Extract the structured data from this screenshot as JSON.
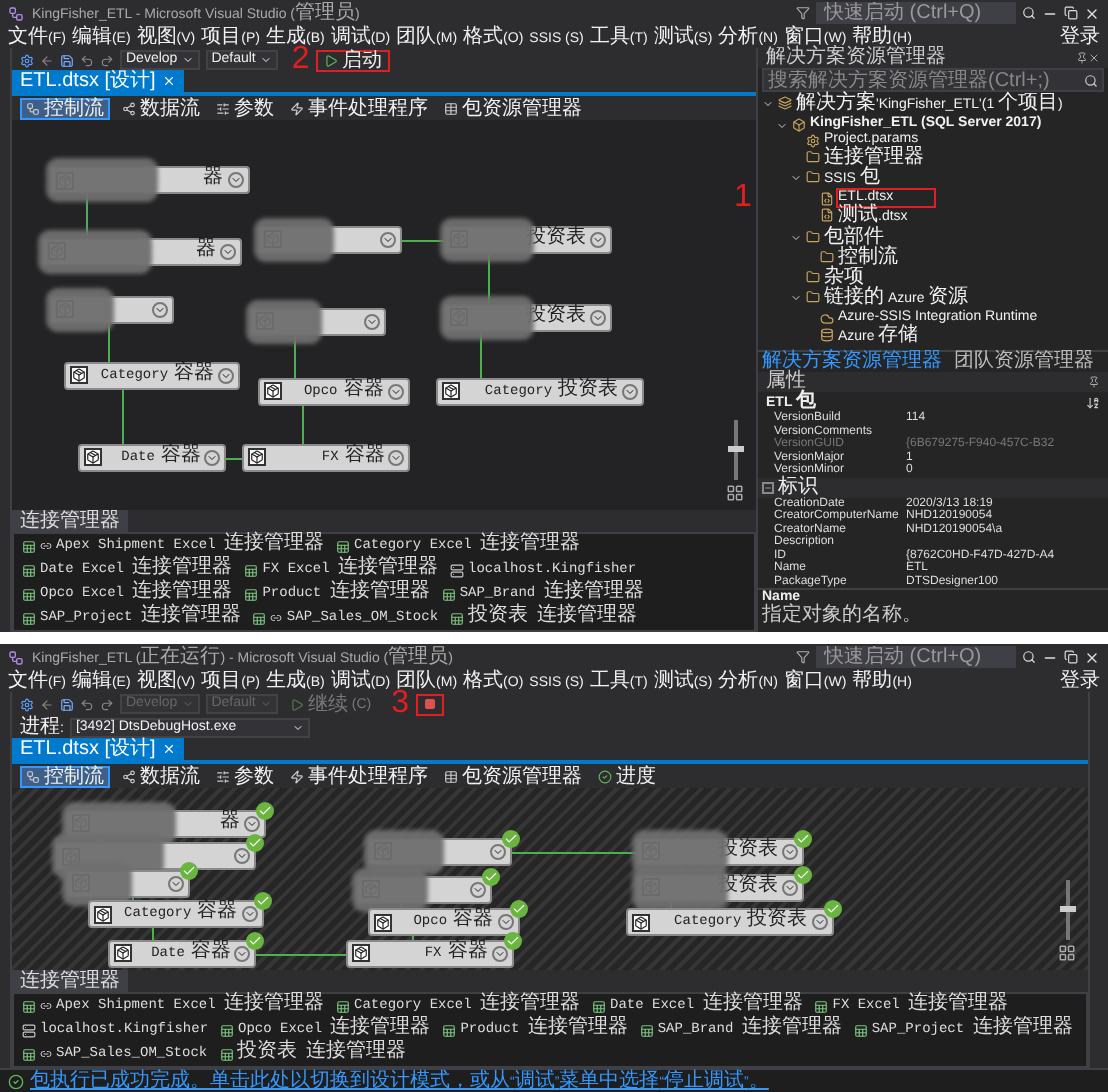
{
  "windows": [
    {
      "title": "KingFisher_ETL - Microsoft Visual Studio (管理员)",
      "running": false,
      "quick_launch": {
        "placeholder": "快速启动 (Ctrl+Q)"
      },
      "menu": [
        "文件(F)",
        "编辑(E)",
        "视图(V)",
        "项目(P)",
        "生成(B)",
        "调试(D)",
        "团队(M)",
        "格式(O)",
        "SSIS (S)",
        "工具(T)",
        "测试(S)",
        "分析(N)",
        "窗口(W)",
        "帮助(H)"
      ],
      "sign_in": "登录",
      "toolbar": {
        "configuration": {
          "label": "Develop",
          "disabled": false
        },
        "platform": {
          "label": "Default",
          "disabled": false
        },
        "buttons": [
          {
            "kind": "start",
            "label": "启动",
            "annotation": "2",
            "disabled": false
          }
        ]
      },
      "document_tab": "ETL.dtsx [设计]",
      "designer_tabs": [
        {
          "label": "控制流",
          "selected": true
        },
        {
          "label": "数据流",
          "selected": false
        },
        {
          "label": "参数",
          "selected": false
        },
        {
          "label": "事件处理程序",
          "selected": false
        },
        {
          "label": "包资源管理器",
          "selected": false
        }
      ],
      "canvas": {
        "zoom": {
          "level": 0.5
        },
        "nodes": [
          {
            "label": "器",
            "redacted": true,
            "succeeded": false
          },
          {
            "redacted": true,
            "succeeded": false
          },
          {
            "label": "投资表",
            "redacted": true,
            "succeeded": false
          },
          {
            "label": "器",
            "redacted": true,
            "succeeded": false
          },
          {
            "redacted": true,
            "succeeded": false
          },
          {
            "label": "投资表",
            "redacted": true,
            "succeeded": false
          },
          {
            "redacted": true,
            "succeeded": false
          },
          {
            "label": "Category 容器",
            "redacted": false,
            "succeeded": false
          },
          {
            "label": "Opco 容器",
            "redacted": false,
            "succeeded": false
          },
          {
            "label": "Category 投资表",
            "redacted": false,
            "succeeded": false
          },
          {
            "label": "Date 容器",
            "redacted": false,
            "succeeded": false
          },
          {
            "label": "FX 容器",
            "redacted": false,
            "succeeded": false
          }
        ]
      },
      "connection_managers": {
        "title": "连接管理器",
        "items": [
          {
            "label": "Apex Shipment Excel 连接管理器",
            "kind": "excel",
            "project": true
          },
          {
            "label": "Category Excel 连接管理器",
            "kind": "excel",
            "project": false
          },
          {
            "label": "Date Excel 连接管理器",
            "kind": "excel",
            "project": false
          },
          {
            "label": "FX Excel 连接管理器",
            "kind": "excel",
            "project": false
          },
          {
            "label": "localhost.Kingfisher",
            "kind": "oledb",
            "project": false
          },
          {
            "label": "Opco Excel 连接管理器",
            "kind": "excel",
            "project": false
          },
          {
            "label": "Product 连接管理器",
            "kind": "excel",
            "project": false
          },
          {
            "label": "SAP_Brand 连接管理器",
            "kind": "excel",
            "project": false
          },
          {
            "label": "SAP_Project 连接管理器",
            "kind": "excel",
            "project": false
          },
          {
            "label": "SAP_Sales_OM_Stock",
            "kind": "excel",
            "project": true
          },
          {
            "label": "投资表 连接管理器",
            "kind": "excel",
            "project": false
          }
        ]
      },
      "solution_explorer": {
        "title": "解决方案资源管理器",
        "search": {
          "placeholder": "搜索解决方案资源管理器(Ctrl+;)"
        },
        "tree": [
          {
            "label": "解决方案'KingFisher_ETL'(1 个项目)",
            "kind": "solution",
            "expanded": true,
            "children": [
              {
                "label": "KingFisher_ETL (SQL Server 2017)",
                "kind": "project",
                "expanded": true,
                "children": [
                  {
                    "label": "Project.params",
                    "kind": "params"
                  },
                  {
                    "label": "连接管理器",
                    "kind": "folder"
                  },
                  {
                    "label": "SSIS 包",
                    "kind": "folder",
                    "expanded": true,
                    "children": [
                      {
                        "label": "ETL.dtsx",
                        "kind": "package",
                        "annotation": "1"
                      },
                      {
                        "label": "测试.dtsx",
                        "kind": "package"
                      }
                    ]
                  },
                  {
                    "label": "包部件",
                    "kind": "folder",
                    "expanded": true,
                    "children": [
                      {
                        "label": "控制流",
                        "kind": "folder"
                      }
                    ]
                  },
                  {
                    "label": "杂项",
                    "kind": "folder"
                  },
                  {
                    "label": "链接的 Azure 资源",
                    "kind": "folder",
                    "expanded": true,
                    "children": [
                      {
                        "label": "Azure-SSIS Integration Runtime",
                        "kind": "runtime"
                      },
                      {
                        "label": "Azure 存储",
                        "kind": "storage"
                      }
                    ]
                  }
                ]
              }
            ]
          }
        ],
        "tabs": [
          {
            "label": "解决方案资源管理器",
            "selected": true
          },
          {
            "label": "团队资源管理器",
            "selected": false
          }
        ]
      },
      "properties": {
        "title": "属性",
        "object": "ETL 包",
        "rows": [
          {
            "kind": "row",
            "name": "VersionBuild",
            "value": "114",
            "disabled": false
          },
          {
            "kind": "row",
            "name": "VersionComments",
            "disabled": false
          },
          {
            "kind": "row",
            "name": "VersionGUID",
            "value": "{6B679275-F940-457C-B32",
            "disabled": true
          },
          {
            "kind": "row",
            "name": "VersionMajor",
            "value": "1",
            "disabled": false
          },
          {
            "kind": "row",
            "name": "VersionMinor",
            "value": "0",
            "disabled": false
          },
          {
            "kind": "category",
            "name": "标识"
          },
          {
            "kind": "row",
            "name": "CreationDate",
            "value": "2020/3/13 18:19",
            "disabled": false
          },
          {
            "kind": "row",
            "name": "CreatorComputerName",
            "value": "NHD120190054",
            "disabled": false
          },
          {
            "kind": "row",
            "name": "CreatorName",
            "value": "NHD120190054\\a",
            "disabled": false
          },
          {
            "kind": "row",
            "name": "Description",
            "disabled": false
          },
          {
            "kind": "row",
            "name": "ID",
            "value": "{8762C0HD-F47D-427D-A4",
            "disabled": false
          },
          {
            "kind": "row",
            "name": "Name",
            "value": "ETL",
            "disabled": false
          },
          {
            "kind": "row",
            "name": "PackageType",
            "value": "DTSDesigner100",
            "disabled": false
          }
        ],
        "description": {
          "title": "Name",
          "text": "指定对象的名称。"
        }
      }
    },
    {
      "title": "KingFisher_ETL (正在运行) - Microsoft Visual Studio (管理员)",
      "running": true,
      "quick_launch": {
        "placeholder": "快速启动 (Ctrl+Q)"
      },
      "menu": [
        "文件(F)",
        "编辑(E)",
        "视图(V)",
        "项目(P)",
        "生成(B)",
        "调试(D)",
        "团队(M)",
        "格式(O)",
        "SSIS (S)",
        "工具(T)",
        "测试(S)",
        "分析(N)",
        "窗口(W)",
        "帮助(H)"
      ],
      "sign_in": "登录",
      "toolbar": {
        "configuration": {
          "label": "Develop",
          "disabled": true
        },
        "platform": {
          "label": "Default",
          "disabled": true
        },
        "buttons": [
          {
            "kind": "start",
            "label": "继续(C)",
            "disabled": true
          },
          {
            "kind": "stop",
            "annotation": "3",
            "disabled": false
          }
        ]
      },
      "debug_toolbar": {
        "process_label": "进程:",
        "process": "[3492] DtsDebugHost.exe"
      },
      "document_tab": "ETL.dtsx [设计]",
      "designer_tabs": [
        {
          "label": "控制流",
          "selected": true
        },
        {
          "label": "数据流",
          "selected": false
        },
        {
          "label": "参数",
          "selected": false
        },
        {
          "label": "事件处理程序",
          "selected": false
        },
        {
          "label": "包资源管理器",
          "selected": false
        },
        {
          "label": "进度",
          "selected": false
        }
      ],
      "canvas": {
        "zoom": {
          "level": 0.5
        },
        "nodes": [
          {
            "label": "器",
            "redacted": true,
            "succeeded": true
          },
          {
            "redacted": true,
            "succeeded": true
          },
          {
            "label": "投资表",
            "redacted": true,
            "succeeded": true
          },
          {
            "redacted": true,
            "succeeded": true
          },
          {
            "redacted": true,
            "succeeded": true
          },
          {
            "label": "投资表",
            "redacted": true,
            "succeeded": true
          },
          {
            "redacted": true,
            "succeeded": true
          },
          {
            "label": "Category 容器",
            "redacted": false,
            "succeeded": true
          },
          {
            "label": "Opco 容器",
            "redacted": false,
            "succeeded": true
          },
          {
            "label": "Category 投资表",
            "redacted": false,
            "succeeded": true
          },
          {
            "label": "Date 容器",
            "redacted": false,
            "succeeded": true
          },
          {
            "label": "FX 容器",
            "redacted": false,
            "succeeded": true
          }
        ]
      },
      "connection_managers": {
        "title": "连接管理器",
        "items": [
          {
            "label": "Apex Shipment Excel 连接管理器",
            "kind": "excel",
            "project": true
          },
          {
            "label": "Category Excel 连接管理器",
            "kind": "excel",
            "project": false
          },
          {
            "label": "Date Excel 连接管理器",
            "kind": "excel",
            "project": false
          },
          {
            "label": "FX Excel 连接管理器",
            "kind": "excel",
            "project": false
          },
          {
            "label": "localhost.Kingfisher",
            "kind": "oledb",
            "project": false
          },
          {
            "label": "Opco Excel 连接管理器",
            "kind": "excel",
            "project": false
          },
          {
            "label": "Product 连接管理器",
            "kind": "excel",
            "project": false
          },
          {
            "label": "SAP_Brand 连接管理器",
            "kind": "excel",
            "project": false
          },
          {
            "label": "SAP_Project 连接管理器",
            "kind": "excel",
            "project": false
          },
          {
            "label": "SAP_Sales_OM_Stock",
            "kind": "excel",
            "project": true
          },
          {
            "label": "投资表 连接管理器",
            "kind": "excel",
            "project": false
          }
        ]
      },
      "status": {
        "text": "包执行已成功完成。单击此处以切换到设计模式，或从“调试”菜单中选择“停止调试”。"
      }
    }
  ]
}
